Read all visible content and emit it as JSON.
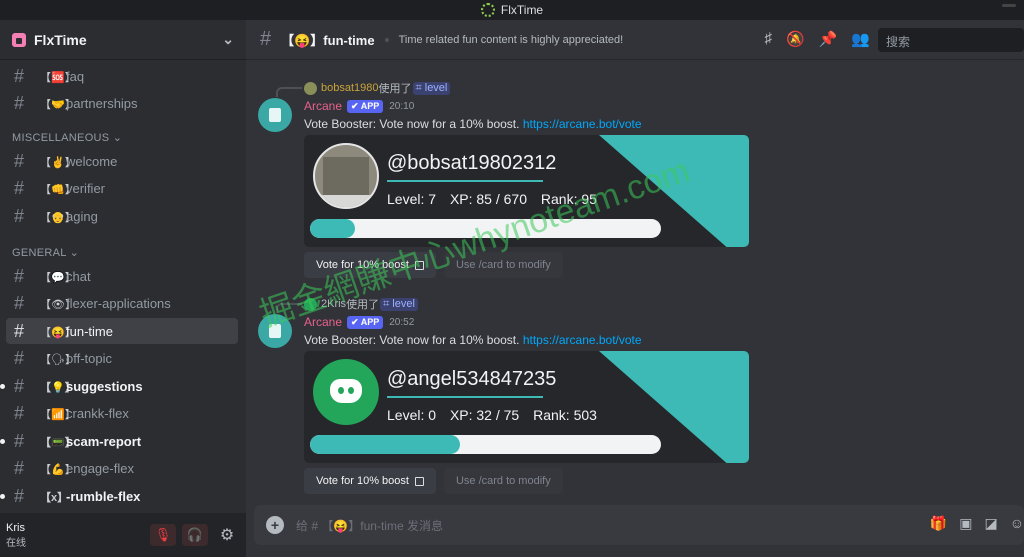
{
  "window_title": "FlxTime",
  "server": {
    "name": "FlxTime"
  },
  "channels_top": [
    {
      "emoji": "【🆘】",
      "name": "faq"
    },
    {
      "emoji": "【🤝】",
      "name": "partnerships"
    }
  ],
  "categories": {
    "misc": "MISCELLANEOUS",
    "general": "GENERAL"
  },
  "channels_misc": [
    {
      "emoji": "【✌】",
      "name": "welcome"
    },
    {
      "emoji": "【👊】",
      "name": "verifier"
    },
    {
      "emoji": "【👴】",
      "name": "aging"
    }
  ],
  "channels_general": [
    {
      "emoji": "【💬】",
      "name": "chat"
    },
    {
      "emoji": "【👁】",
      "name": "flexer-applications"
    },
    {
      "emoji": "【😝】",
      "name": "fun-time"
    },
    {
      "emoji": "【🗣】",
      "name": "off-topic"
    },
    {
      "emoji": "【💡】",
      "name": "suggestions"
    },
    {
      "emoji": "【📶】",
      "name": "crankk-flex"
    },
    {
      "emoji": "【📟】",
      "name": "scam-report"
    },
    {
      "emoji": "【💪】",
      "name": "engage-flex"
    },
    {
      "emoji": "【x】",
      "name": "-rumble-flex"
    }
  ],
  "user": {
    "name": "Kris",
    "status": "在线"
  },
  "header": {
    "channel": "【😝】fun-time",
    "topic": "Time related fun content is highly appreciated!",
    "search_placeholder": "搜索"
  },
  "messages": [
    {
      "reply_user": "bobsat1980",
      "reply_used": "使用了",
      "reply_cmd": "⌗ level",
      "author": "Arcane",
      "badge": "✔ APP",
      "time": "20:10",
      "text": "Vote Booster: Vote now for a 10% boost.",
      "link": "https://arcane.bot/vote",
      "card": {
        "username": "@bobsat19802312",
        "level_label": "Level: 7",
        "xp_label": "XP: 85 / 670",
        "rank_label": "Rank: 95",
        "progress": 0.127
      },
      "btn_vote": "Vote for 10% boost",
      "btn_modify": "Use /card to modify"
    },
    {
      "reply_user": "2Kris",
      "reply_used": "使用了",
      "reply_cmd": "⌗ level",
      "author": "Arcane",
      "badge": "✔ APP",
      "time": "20:52",
      "text": "Vote Booster: Vote now for a 10% boost.",
      "link": "https://arcane.bot/vote",
      "card": {
        "username": "@angel534847235",
        "level_label": "Level: 0",
        "xp_label": "XP: 32 / 75",
        "rank_label": "Rank: 503",
        "progress": 0.427
      },
      "btn_vote": "Vote for 10% boost",
      "btn_modify": "Use /card to modify"
    }
  ],
  "composer_placeholder": "给 # 【😝】fun-time 发消息",
  "watermark": "掘金網賺中心whynoteam.com",
  "colors": {
    "accent": "#3dbab6",
    "link": "#00a8fc",
    "bot_name": "#e8618c",
    "app_badge": "#5865f2"
  }
}
